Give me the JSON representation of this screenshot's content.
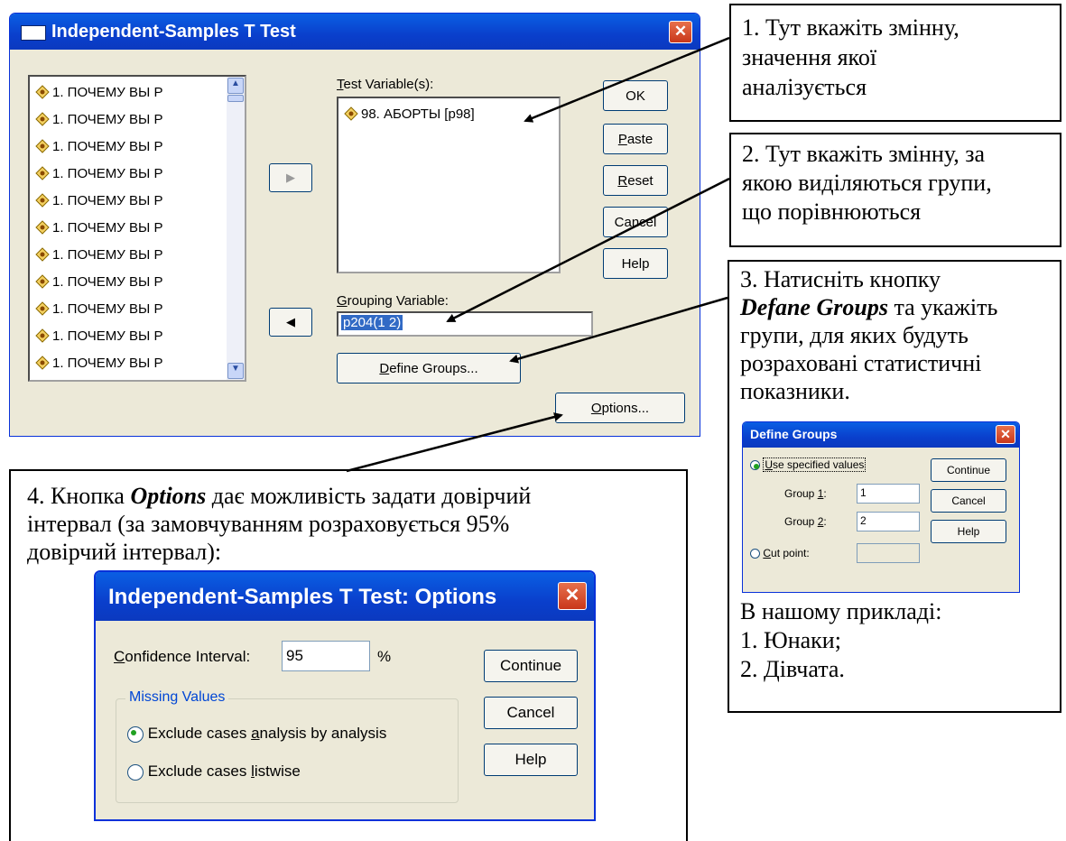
{
  "main_dialog": {
    "title": "Independent-Samples T Test",
    "close": "✕",
    "variable_list": [
      "1. ПОЧЕМУ ВЫ Р",
      "1. ПОЧЕМУ ВЫ Р",
      "1. ПОЧЕМУ ВЫ Р",
      "1. ПОЧЕМУ ВЫ Р",
      "1. ПОЧЕМУ ВЫ Р",
      "1. ПОЧЕМУ ВЫ Р",
      "1. ПОЧЕМУ ВЫ Р",
      "1. ПОЧЕМУ ВЫ Р",
      "1. ПОЧЕМУ ВЫ Р",
      "1. ПОЧЕМУ ВЫ Р",
      "1. ПОЧЕМУ ВЫ Р"
    ],
    "move_right_arrow": "▶",
    "move_left_arrow": "◀",
    "test_variables_label_u": "T",
    "test_variables_label_rest": "est Variable(s):",
    "test_variable_item": "98. АБОРТЫ [p98]",
    "grouping_label_u": "G",
    "grouping_label_rest": "rouping Variable:",
    "grouping_value": "p204(1 2)",
    "define_groups_u": "D",
    "define_groups_rest": "efine Groups...",
    "options_u": "O",
    "options_rest": "ptions...",
    "ok": "OK",
    "paste_u": "P",
    "paste_rest": "aste",
    "reset_u": "R",
    "reset_rest": "eset",
    "cancel": "Cancel",
    "help": "Help"
  },
  "note1": {
    "lines": [
      "1. Тут вкажіть змінну,",
      "значення якої",
      "аналізується"
    ]
  },
  "note2": {
    "lines": [
      "2. Тут вкажіть змінну, за",
      "якою виділяються групи,",
      "що порівнюються"
    ]
  },
  "note3": {
    "line1": "3. Натисніть кнопку",
    "line2_bold": "Defane Groups",
    "line2_rest": " та укажіть",
    "lines_after": [
      "групи, для яких будуть",
      "розраховані статистичні",
      "показники."
    ],
    "example_lines": [
      "В нашому прикладі:",
      "1. Юнаки;",
      "2. Дівчата."
    ]
  },
  "define_groups_dialog": {
    "title": "Define Groups",
    "close": "✕",
    "use_specified_u": "U",
    "use_specified_rest": "se specified values",
    "group1_pre": "Group ",
    "group1_u": "1",
    "group1_post": ":",
    "group1_value": "1",
    "group2_pre": "Group ",
    "group2_u": "2",
    "group2_post": ":",
    "group2_value": "2",
    "cut_point_u": "C",
    "cut_point_rest": "ut point:",
    "continue": "Continue",
    "cancel": "Cancel",
    "help": "Help"
  },
  "note4": {
    "line1_pre": "4. Кнопка ",
    "line1_bold": "Options",
    "line1_post": "  дає можливість задати довірчий",
    "line2": "інтервал (за замовчуванням розраховується 95%",
    "line3": "довірчий інтервал):"
  },
  "options_dialog": {
    "title": "Independent-Samples T Test: Options",
    "close": "✕",
    "confidence_u": "C",
    "confidence_rest": "onfidence Interval:",
    "confidence_value": "95",
    "percent": "%",
    "missing_values_legend": "Missing Values",
    "exclude_analysis_pre": "Exclude cases ",
    "exclude_analysis_u": "a",
    "exclude_analysis_post": "nalysis by analysis",
    "exclude_listwise_pre": "Exclude cases ",
    "exclude_listwise_u": "l",
    "exclude_listwise_post": "istwise",
    "continue": "Continue",
    "cancel": "Cancel",
    "help": "Help"
  }
}
